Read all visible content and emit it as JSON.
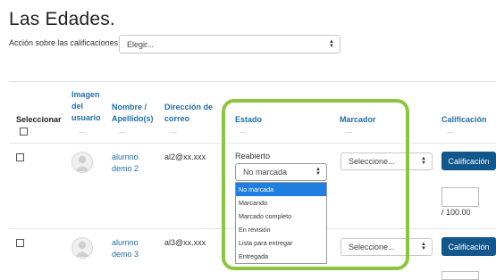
{
  "page": {
    "title": "Las Edades."
  },
  "bulk_action": {
    "label": "Acción sobre las calificaciones",
    "value": "Elegir..."
  },
  "table": {
    "headers": {
      "select": "Seleccionar",
      "image": "Imagen del usuario",
      "name": "Nombre / Apellido(s)",
      "email": "Dirección de correo",
      "status": "Estado",
      "marker": "Marcador",
      "grade": "Calificación"
    },
    "sort_placeholder": "—",
    "rows": [
      {
        "name": "alumno demo 2",
        "email": "al2@xx.xxx",
        "status": "Reabierto",
        "marker": "Seleccione...",
        "grade_button": "Calificación",
        "grade_suffix": "/ 100.00"
      },
      {
        "name": "alumno demo 3",
        "email": "al3@xx.xxx",
        "marker": "Seleccione...",
        "grade_button": "Calificación"
      }
    ]
  },
  "workflow_select": {
    "value": "No marcada",
    "options": [
      "No marcada",
      "Marcando",
      "Marcado completo",
      "En revisión",
      "Lista para entregar",
      "Entregada"
    ],
    "selected_index": 0
  },
  "colors": {
    "highlight": "#8cc63f",
    "link": "#1f6ea7",
    "button": "#12578c",
    "option_selected": "#1e7fe0"
  }
}
